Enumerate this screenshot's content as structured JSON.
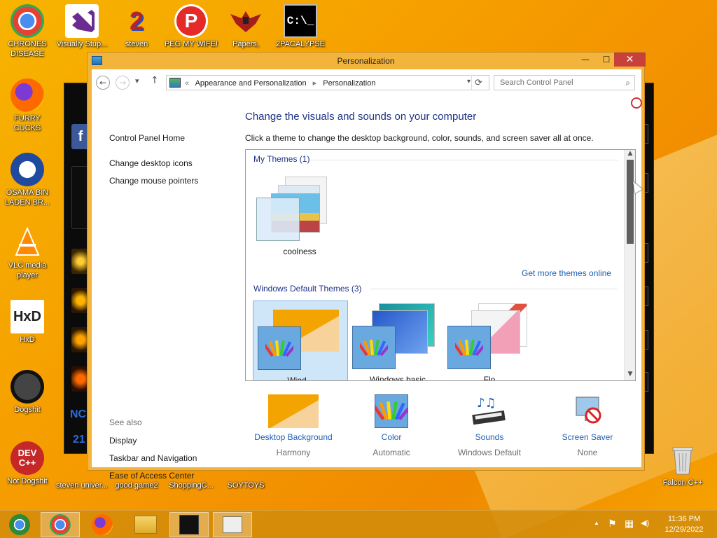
{
  "desktop": {
    "icons": [
      {
        "label": "CHRONES DISEASE",
        "icon": "chrome-icon"
      },
      {
        "label": "Visually Stup...",
        "icon": "visual-studio-icon"
      },
      {
        "label": "steven",
        "icon": "number-2-icon"
      },
      {
        "label": "PEG MY WIFE!",
        "icon": "p-logo-icon"
      },
      {
        "label": "Papers,",
        "icon": "eagle-emblem-icon"
      },
      {
        "label": "2PACALYPSE",
        "icon": "command-prompt-icon"
      },
      {
        "label": "FURRY CUCKS",
        "icon": "firefox-icon"
      },
      {
        "label": "OSAMA BIN LADEN BR...",
        "icon": "obama-logo-icon"
      },
      {
        "label": "VLC media player",
        "icon": "vlc-cone-icon"
      },
      {
        "label": "HxD",
        "icon": "hxd-icon"
      },
      {
        "label": "Dogshit",
        "icon": "codeblocks-icon"
      },
      {
        "label": "Not Dogshit",
        "icon": "devcpp-icon"
      },
      {
        "label": "steven univer...",
        "icon": "steven-universe-icon"
      },
      {
        "label": "good game2",
        "icon": "good-game-icon"
      },
      {
        "label": "ShoppingC...",
        "icon": "shopping-icon"
      },
      {
        "label": "SOYTOYS",
        "icon": "soytoys-icon"
      },
      {
        "label": "Falcon C++",
        "icon": "recycle-bin-icon"
      }
    ],
    "bg_window_text": {
      "f": "f",
      "no": "NC",
      "num": "21"
    }
  },
  "window": {
    "title": "Personalization",
    "minimize": "—",
    "maximize": "☐",
    "close": "✕",
    "breadcrumb": {
      "prefix": "«",
      "part1": "Appearance and Personalization",
      "sep": "▸",
      "part2": "Personalization"
    },
    "search_placeholder": "Search Control Panel"
  },
  "left_pane": {
    "home": "Control Panel Home",
    "links": [
      "Change desktop icons",
      "Change mouse pointers"
    ],
    "see_also_label": "See also",
    "see_also": [
      "Display",
      "Taskbar and Navigation",
      "Ease of Access Center"
    ]
  },
  "content": {
    "heading": "Change the visuals and sounds on your computer",
    "subheading": "Click a theme to change the desktop background, color, sounds, and screen saver all at once.",
    "my_themes_label": "My Themes (1)",
    "my_theme_name": "coolness",
    "get_more_link": "Get more themes online",
    "default_themes_label": "Windows Default Themes (3)",
    "default_themes": [
      {
        "name": "Wind...",
        "selected": true
      },
      {
        "name": "Windows basic",
        "selected": false
      },
      {
        "name": "Flo...",
        "selected": false
      }
    ]
  },
  "bottom_bar": [
    {
      "label": "Desktop Background",
      "value": "Harmony"
    },
    {
      "label": "Color",
      "value": "Automatic"
    },
    {
      "label": "Sounds",
      "value": "Windows Default"
    },
    {
      "label": "Screen Saver",
      "value": "None"
    }
  ],
  "taskbar": {
    "items": [
      "chrome-alt-icon",
      "chrome-icon",
      "firefox-icon",
      "file-explorer-icon",
      "app-icon",
      "control-panel-icon"
    ],
    "tray": {
      "up_arrow": "▲",
      "flag": "⚑",
      "network": "▦",
      "volume": "◀)"
    },
    "time": "11:36 PM",
    "date": "12/29/2022"
  },
  "colors": {
    "accent_link": "#1e5fb5",
    "heading": "#1e3287",
    "title_frame": "#f3b43b",
    "close_red": "#c7413a"
  }
}
